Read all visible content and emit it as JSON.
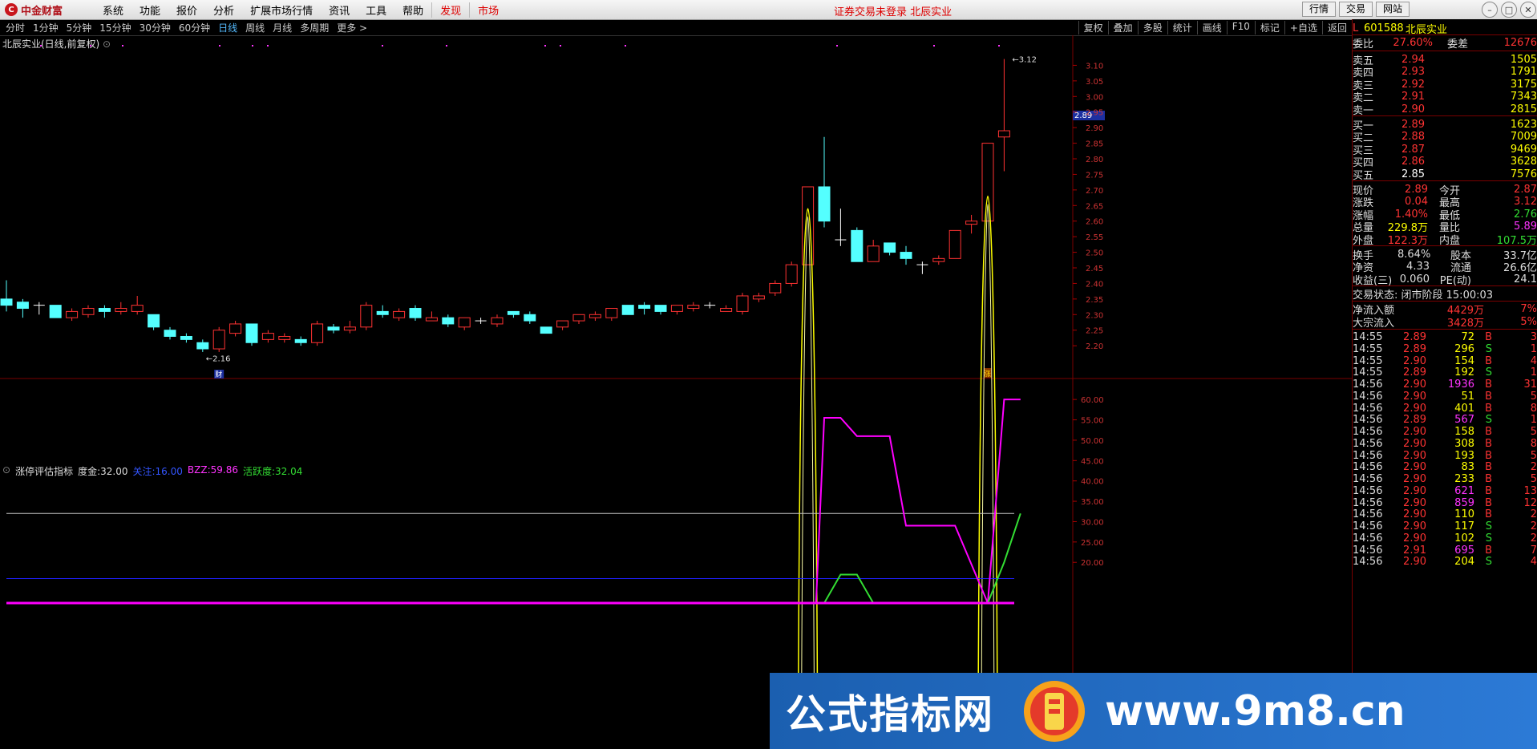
{
  "app": {
    "logo_text": "中金财富",
    "logo_mark": "C"
  },
  "menu": [
    "系统",
    "功能",
    "报价",
    "分析",
    "扩展市场行情",
    "资讯",
    "工具",
    "帮助"
  ],
  "menu_special": [
    "发现",
    "市场"
  ],
  "notice": "证券交易未登录 北辰实业",
  "top_buttons": [
    "行情",
    "交易",
    "网站"
  ],
  "periods": [
    "分时",
    "1分钟",
    "5分钟",
    "15分钟",
    "30分钟",
    "60分钟",
    "日线",
    "周线",
    "月线",
    "多周期",
    "更多 >"
  ],
  "active_period": "日线",
  "right_tools": [
    "复权",
    "叠加",
    "多股",
    "统计",
    "画线",
    "F10",
    "标记",
    "+自选",
    "返回"
  ],
  "chart_title": "北辰实业(日线,前复权)",
  "indicator": {
    "name": "涨停评估指标",
    "fields": [
      {
        "label": "度金:",
        "value": "32.00",
        "color": "#dddddd"
      },
      {
        "label": "关注:",
        "value": "16.00",
        "color": "#3355ff"
      },
      {
        "label": "BZZ:",
        "value": "59.86",
        "color": "#ff33ff"
      },
      {
        "label": "活跃度:",
        "value": "32.04",
        "color": "#33dd33"
      }
    ]
  },
  "chart_data": [
    {
      "type": "candlestick",
      "title": "北辰实业(日线,前复权)",
      "ylim": [
        2.1,
        3.15
      ],
      "y_ticks": [
        "3.10",
        "3.05",
        "3.00",
        "2.95",
        "2.90",
        "2.85",
        "2.80",
        "2.75",
        "2.70",
        "2.65",
        "2.60",
        "2.55",
        "2.50",
        "2.45",
        "2.40",
        "2.35",
        "2.30",
        "2.25",
        "2.20"
      ],
      "current_price_label": "2.89",
      "annotations": [
        "3.12",
        "2.16",
        "财",
        "涨"
      ],
      "candles": [
        [
          2.35,
          2.33,
          2.41,
          2.31
        ],
        [
          2.34,
          2.32,
          2.35,
          2.29
        ],
        [
          2.33,
          2.33,
          2.34,
          2.3
        ],
        [
          2.33,
          2.29,
          2.33,
          2.29
        ],
        [
          2.29,
          2.31,
          2.32,
          2.28
        ],
        [
          2.3,
          2.32,
          2.33,
          2.29
        ],
        [
          2.32,
          2.31,
          2.33,
          2.29
        ],
        [
          2.31,
          2.32,
          2.34,
          2.3
        ],
        [
          2.31,
          2.33,
          2.36,
          2.3
        ],
        [
          2.3,
          2.26,
          2.3,
          2.25
        ],
        [
          2.25,
          2.23,
          2.26,
          2.22
        ],
        [
          2.23,
          2.22,
          2.24,
          2.21
        ],
        [
          2.21,
          2.19,
          2.22,
          2.18
        ],
        [
          2.19,
          2.25,
          2.26,
          2.18
        ],
        [
          2.24,
          2.27,
          2.28,
          2.23
        ],
        [
          2.27,
          2.21,
          2.27,
          2.2
        ],
        [
          2.22,
          2.24,
          2.25,
          2.21
        ],
        [
          2.22,
          2.23,
          2.24,
          2.21
        ],
        [
          2.22,
          2.21,
          2.23,
          2.2
        ],
        [
          2.21,
          2.27,
          2.28,
          2.2
        ],
        [
          2.26,
          2.25,
          2.27,
          2.24
        ],
        [
          2.25,
          2.26,
          2.28,
          2.24
        ],
        [
          2.26,
          2.33,
          2.34,
          2.25
        ],
        [
          2.31,
          2.3,
          2.33,
          2.29
        ],
        [
          2.29,
          2.31,
          2.32,
          2.28
        ],
        [
          2.32,
          2.29,
          2.33,
          2.28
        ],
        [
          2.28,
          2.29,
          2.31,
          2.28
        ],
        [
          2.29,
          2.27,
          2.3,
          2.26
        ],
        [
          2.26,
          2.29,
          2.29,
          2.25
        ],
        [
          2.28,
          2.28,
          2.29,
          2.27
        ],
        [
          2.27,
          2.29,
          2.3,
          2.26
        ],
        [
          2.31,
          2.3,
          2.31,
          2.29
        ],
        [
          2.3,
          2.28,
          2.31,
          2.27
        ],
        [
          2.26,
          2.24,
          2.26,
          2.24
        ],
        [
          2.26,
          2.28,
          2.28,
          2.25
        ],
        [
          2.28,
          2.3,
          2.3,
          2.27
        ],
        [
          2.29,
          2.3,
          2.31,
          2.28
        ],
        [
          2.29,
          2.32,
          2.32,
          2.28
        ],
        [
          2.33,
          2.3,
          2.33,
          2.3
        ],
        [
          2.33,
          2.32,
          2.34,
          2.3
        ],
        [
          2.33,
          2.31,
          2.33,
          2.3
        ],
        [
          2.31,
          2.33,
          2.33,
          2.3
        ],
        [
          2.32,
          2.33,
          2.34,
          2.31
        ],
        [
          2.33,
          2.33,
          2.34,
          2.32
        ],
        [
          2.31,
          2.32,
          2.33,
          2.31
        ],
        [
          2.31,
          2.36,
          2.37,
          2.3
        ],
        [
          2.35,
          2.36,
          2.37,
          2.34
        ],
        [
          2.37,
          2.4,
          2.41,
          2.36
        ],
        [
          2.4,
          2.46,
          2.47,
          2.39
        ],
        [
          2.46,
          2.71,
          2.71,
          2.46
        ],
        [
          2.71,
          2.6,
          2.87,
          2.58
        ],
        [
          2.54,
          2.54,
          2.64,
          2.52
        ],
        [
          2.57,
          2.47,
          2.58,
          2.47
        ],
        [
          2.47,
          2.52,
          2.54,
          2.47
        ],
        [
          2.53,
          2.5,
          2.53,
          2.49
        ],
        [
          2.5,
          2.48,
          2.52,
          2.46
        ],
        [
          2.46,
          2.46,
          2.47,
          2.43
        ],
        [
          2.47,
          2.48,
          2.49,
          2.46
        ],
        [
          2.48,
          2.57,
          2.57,
          2.48
        ],
        [
          2.59,
          2.6,
          2.62,
          2.56
        ],
        [
          2.6,
          2.85,
          2.85,
          2.6
        ],
        [
          2.87,
          2.89,
          3.12,
          2.76
        ]
      ]
    },
    {
      "type": "line",
      "name": "涨停评估指标",
      "ylim": [
        10,
        62
      ],
      "y_ticks": [
        "60.00",
        "55.00",
        "50.00",
        "45.00",
        "40.00",
        "35.00",
        "30.00",
        "25.00",
        "20.00"
      ],
      "horizontal_lines": [
        {
          "value": 32.0,
          "color": "#c0c0c0"
        },
        {
          "value": 16.0,
          "color": "#2020ff"
        }
      ],
      "series": [
        {
          "color": "#ff00ff",
          "points": [
            [
              49.5,
              10
            ],
            [
              50,
              55.5
            ],
            [
              51,
              55.5
            ],
            [
              52,
              51
            ],
            [
              54,
              51
            ],
            [
              55,
              29
            ],
            [
              58,
              29
            ],
            [
              60,
              10
            ],
            [
              61,
              60
            ],
            [
              62,
              60
            ]
          ]
        },
        {
          "color": "#33dd33",
          "points": [
            [
              50,
              10
            ],
            [
              51,
              17
            ],
            [
              52,
              17
            ],
            [
              53,
              10
            ],
            [
              60,
              10
            ],
            [
              61,
              20
            ],
            [
              62,
              32
            ]
          ]
        }
      ]
    }
  ],
  "quote": {
    "code_prefix": "L",
    "code": "601588",
    "name": "北辰实业",
    "weibi": {
      "l1": "委比",
      "v1": "27.60%",
      "l2": "委差",
      "v2": "12676"
    },
    "sell": [
      {
        "label": "卖五",
        "price": "2.94",
        "vol": "1505"
      },
      {
        "label": "卖四",
        "price": "2.93",
        "vol": "1791"
      },
      {
        "label": "卖三",
        "price": "2.92",
        "vol": "3175"
      },
      {
        "label": "卖二",
        "price": "2.91",
        "vol": "7343"
      },
      {
        "label": "卖一",
        "price": "2.90",
        "vol": "2815"
      }
    ],
    "buy": [
      {
        "label": "买一",
        "price": "2.89",
        "vol": "1623"
      },
      {
        "label": "买二",
        "price": "2.88",
        "vol": "7009"
      },
      {
        "label": "买三",
        "price": "2.87",
        "vol": "9469"
      },
      {
        "label": "买四",
        "price": "2.86",
        "vol": "3628"
      },
      {
        "label": "买五",
        "price": "2.85",
        "vol": "7576"
      }
    ],
    "stats": [
      {
        "l1": "现价",
        "v1": "2.89",
        "c1": "#ff3333",
        "l2": "今开",
        "v2": "2.87",
        "c2": "#ff3333"
      },
      {
        "l1": "涨跌",
        "v1": "0.04",
        "c1": "#ff3333",
        "l2": "最高",
        "v2": "3.12",
        "c2": "#ff3333"
      },
      {
        "l1": "涨幅",
        "v1": "1.40%",
        "c1": "#ff3333",
        "l2": "最低",
        "v2": "2.76",
        "c2": "#33dd33"
      },
      {
        "l1": "总量",
        "v1": "229.8万",
        "c1": "#ffff00",
        "l2": "量比",
        "v2": "5.89",
        "c2": "#ff33ff"
      },
      {
        "l1": "外盘",
        "v1": "122.3万",
        "c1": "#ff3333",
        "l2": "内盘",
        "v2": "107.5万",
        "c2": "#33dd33"
      }
    ],
    "stats2": [
      {
        "l1": "换手",
        "v1": "8.64%",
        "l2": "股本",
        "v2": "33.7亿"
      },
      {
        "l1": "净资",
        "v1": "4.33",
        "l2": "流通",
        "v2": "26.6亿"
      },
      {
        "l1": "收益(三)",
        "v1": "0.060",
        "l2": "PE(动)",
        "v2": "24.1"
      }
    ],
    "trade_status": "交易状态: 闭市阶段 15:00:03",
    "flows": [
      {
        "label": "净流入额",
        "v": "4429万",
        "p": "7%"
      },
      {
        "label": "大宗流入",
        "v": "3428万",
        "p": "5%"
      }
    ],
    "ticks": [
      [
        "14:55",
        "2.89",
        "72",
        "B",
        "3"
      ],
      [
        "14:55",
        "2.89",
        "296",
        "S",
        "1"
      ],
      [
        "14:55",
        "2.90",
        "154",
        "B",
        "4"
      ],
      [
        "14:55",
        "2.89",
        "192",
        "S",
        "1"
      ],
      [
        "14:56",
        "2.90",
        "1936",
        "B",
        "31"
      ],
      [
        "14:56",
        "2.90",
        "51",
        "B",
        "5"
      ],
      [
        "14:56",
        "2.90",
        "401",
        "B",
        "8"
      ],
      [
        "14:56",
        "2.89",
        "567",
        "S",
        "1"
      ],
      [
        "14:56",
        "2.90",
        "158",
        "B",
        "5"
      ],
      [
        "14:56",
        "2.90",
        "308",
        "B",
        "8"
      ],
      [
        "14:56",
        "2.90",
        "193",
        "B",
        "5"
      ],
      [
        "14:56",
        "2.90",
        "83",
        "B",
        "2"
      ],
      [
        "14:56",
        "2.90",
        "233",
        "B",
        "5"
      ],
      [
        "14:56",
        "2.90",
        "621",
        "B",
        "13"
      ],
      [
        "14:56",
        "2.90",
        "859",
        "B",
        "12"
      ],
      [
        "14:56",
        "2.90",
        "110",
        "B",
        "2"
      ],
      [
        "14:56",
        "2.90",
        "117",
        "S",
        "2"
      ],
      [
        "14:56",
        "2.90",
        "102",
        "S",
        "2"
      ],
      [
        "14:56",
        "2.91",
        "695",
        "B",
        "7"
      ],
      [
        "14:56",
        "2.90",
        "204",
        "S",
        "4"
      ]
    ]
  },
  "watermark": {
    "left": "公式指标网",
    "right": "www.9m8.cn"
  }
}
